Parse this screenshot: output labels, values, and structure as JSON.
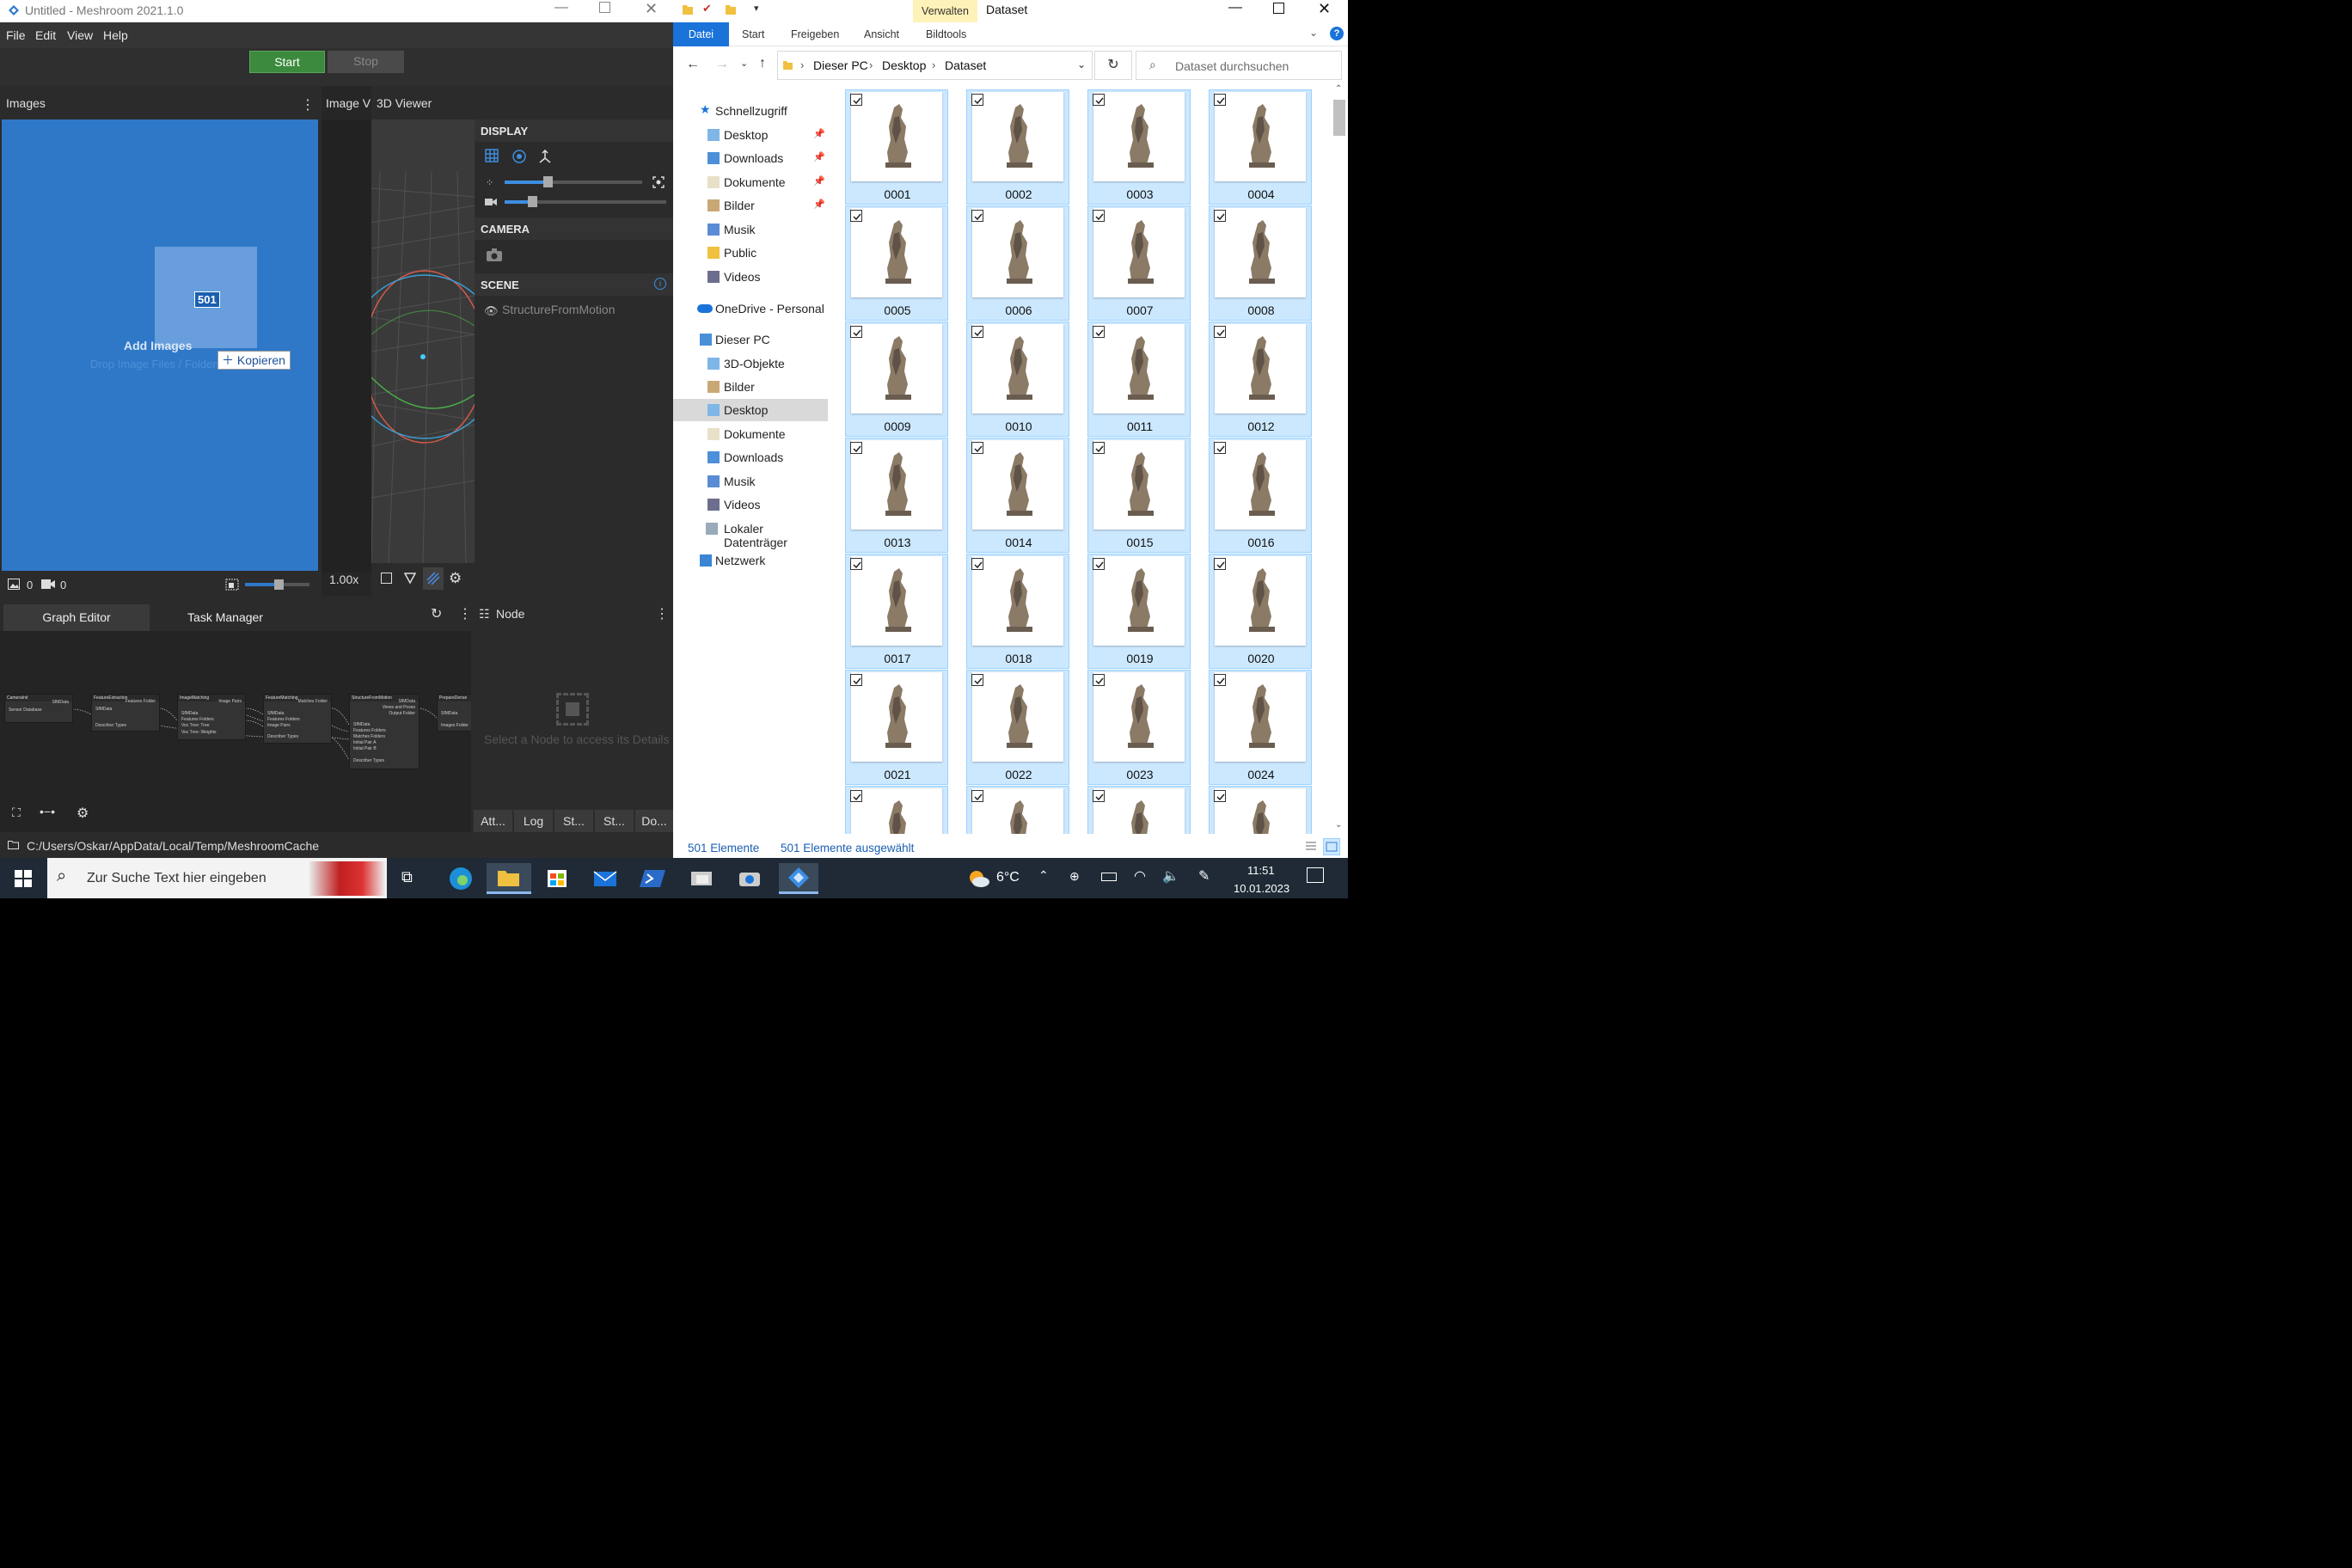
{
  "meshroom": {
    "title": "Untitled - Meshroom 2021.1.0",
    "menu": [
      "File",
      "Edit",
      "View",
      "Help"
    ],
    "start_label": "Start",
    "stop_label": "Stop",
    "images_panel_title": "Images",
    "image_viewer_tab": "Image V",
    "viewer3d_tab": "3D Viewer",
    "drag_count": "501",
    "add_images_label": "Add Images",
    "drop_hint": "Drop Image Files / Folders",
    "copy_tooltip": "Kopieren",
    "image_count": "0",
    "camera_count": "0",
    "zoom_label": "1.00x",
    "display_section": "DISPLAY",
    "camera_section": "CAMERA",
    "scene_section": "SCENE",
    "scene_item": "StructureFromMotion",
    "graph_editor_tab": "Graph Editor",
    "task_manager_tab": "Task Manager",
    "node_panel_title": "Node",
    "node_placeholder": "Select a Node to access its Details",
    "node_tabs": [
      "Att...",
      "Log",
      "St...",
      "St...",
      "Do..."
    ],
    "cache_path": "C:/Users/Oskar/AppData/Local/Temp/MeshroomCache",
    "nodes": [
      {
        "title": "CameraInit",
        "ports": [
          "Sensor Database",
          "SfMData"
        ]
      },
      {
        "title": "FeatureExtraction",
        "ports": [
          "SfMData",
          "Describer Types",
          "Features Folder"
        ]
      },
      {
        "title": "ImageMatching",
        "ports": [
          "SfMData",
          "Features Folders",
          "Voc Tree: Tree",
          "Voc Tree: Weights",
          "Image Pairs"
        ]
      },
      {
        "title": "FeatureMatching",
        "ports": [
          "SfMData",
          "Features Folders",
          "Image Pairs",
          "Describer Types",
          "Matches Folder"
        ]
      },
      {
        "title": "StructureFromMotion",
        "ports": [
          "SfMData",
          "Features Folders",
          "Matches Folders",
          "Initial Pair A",
          "Initial Pair B",
          "Describer Types",
          "SfMData",
          "Views and Poses",
          "Output Folder"
        ]
      },
      {
        "title": "PrepareDense",
        "ports": [
          "SfMData",
          "Images Folder"
        ]
      }
    ],
    "colors": {
      "accent": "#2f78c8",
      "start_green": "#3b8a3d"
    }
  },
  "explorer": {
    "tab_context": "Verwalten",
    "window_title": "Dataset",
    "ribbon_tabs": [
      "Datei",
      "Start",
      "Freigeben",
      "Ansicht",
      "Bildtools"
    ],
    "breadcrumb": [
      "Dieser PC",
      "Desktop",
      "Dataset"
    ],
    "search_placeholder": "Dataset durchsuchen",
    "nav": {
      "quick_access": "Schnellzugriff",
      "quick_items": [
        "Desktop",
        "Downloads",
        "Dokumente",
        "Bilder",
        "Musik",
        "Public",
        "Videos"
      ],
      "onedrive": "OneDrive - Personal",
      "this_pc": "Dieser PC",
      "pc_items": [
        "3D-Objekte",
        "Bilder",
        "Desktop",
        "Dokumente",
        "Downloads",
        "Musik",
        "Videos",
        "Lokaler Datenträger"
      ],
      "network": "Netzwerk"
    },
    "files": [
      "0001",
      "0002",
      "0003",
      "0004",
      "0005",
      "0006",
      "0007",
      "0008",
      "0009",
      "0010",
      "0011",
      "0012",
      "0013",
      "0014",
      "0015",
      "0016",
      "0017",
      "0018",
      "0019",
      "0020",
      "0021",
      "0022",
      "0023",
      "0024",
      "",
      "",
      "",
      ""
    ],
    "status_count": "501 Elemente",
    "status_selected": "501 Elemente ausgewählt",
    "colors": {
      "selection": "#cce8ff",
      "accent": "#1a73d9"
    }
  },
  "taskbar": {
    "search_placeholder": "Zur Suche Text hier eingeben",
    "weather": "6°C",
    "time": "11:51",
    "date": "10.01.2023"
  }
}
